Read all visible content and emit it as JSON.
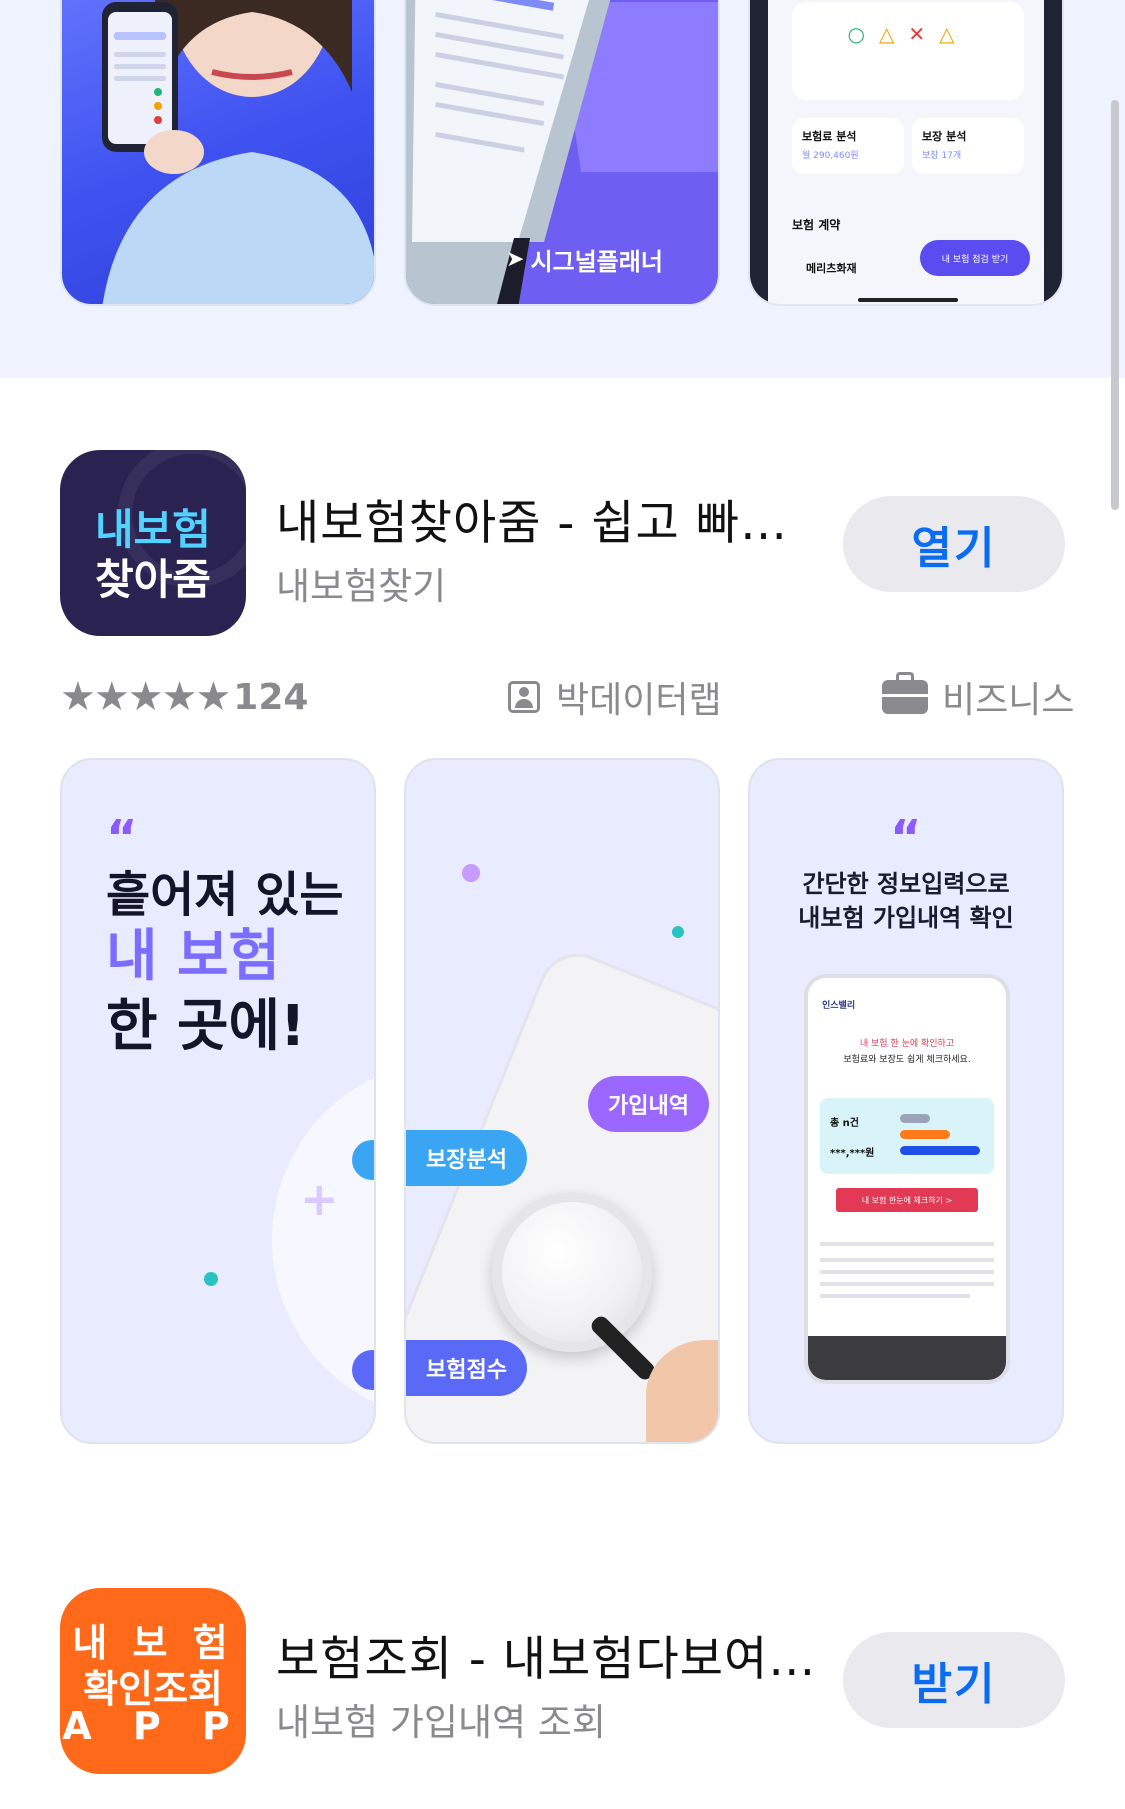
{
  "top_screenshots": {
    "middle_caption": "시그널플래너",
    "right_card1_title": "보험료 분석",
    "right_card1_value": "월 290,460원",
    "right_card2_title": "보장 분석",
    "right_card2_value": "보장 17개",
    "right_section_title": "보험 계약",
    "right_item": "메리츠화재",
    "right_button": "내 보험 점검 받기"
  },
  "app1": {
    "icon_line1": "내보험",
    "icon_line2": "찾아줌",
    "title": "내보험찾아줌 - 쉽고 빠…",
    "subtitle": "내보험찾기",
    "button": "열기",
    "rating_count": "124",
    "developer": "박데이터랩",
    "category": "비즈니스",
    "rating": 5
  },
  "screenshots": {
    "s1_quote": "“",
    "s1_line1": "흩어져 있는",
    "s1_line2": "내 보험",
    "s1_line3": "한 곳에!",
    "s2_tag1": "가입내역",
    "s2_tag2": "보장분석",
    "s2_tag3": "보험점수",
    "s3_quote": "“",
    "s3_line1": "간단한 정보입력으로",
    "s3_line2": "내보험 가입내역 확인",
    "s3_phone_brand": "인스밸리",
    "s3_phone_line1": "내 보험 한 눈에 확인하고",
    "s3_phone_line2": "보험료와 보장도 쉽게 체크하세요.",
    "s3_phone_count": "총 n건",
    "s3_phone_amount": "***,***원",
    "s3_phone_button": "내 보험 한눈에 체크하기 >"
  },
  "app2": {
    "icon_line1": "내 보 험",
    "icon_line2": "확인조회",
    "icon_line3": "A P P",
    "title": "보험조회 - 내보험다보여…",
    "subtitle": "내보험 가입내역 조회",
    "button": "받기"
  },
  "colors": {
    "accent_blue": "#0a6cf3",
    "band_bg": "#eef3ff",
    "purple": "#8a5cff",
    "orange_icon": "#ff6a1a",
    "dark_icon": "#2a2352"
  }
}
